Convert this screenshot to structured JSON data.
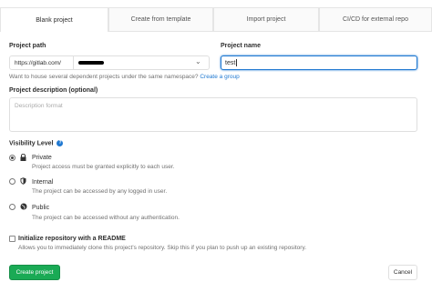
{
  "tabs": [
    {
      "label": "Blank project",
      "active": true
    },
    {
      "label": "Create from template",
      "active": false
    },
    {
      "label": "Import project",
      "active": false
    },
    {
      "label": "CI/CD for external repo",
      "active": false
    }
  ],
  "project_path": {
    "label": "Project path",
    "prefix": "https://gitlab.com/"
  },
  "project_name": {
    "label": "Project name",
    "value": "test"
  },
  "namespace_help": {
    "text": "Want to house several dependent projects under the same namespace?",
    "link": "Create a group"
  },
  "description": {
    "label": "Project description (optional)",
    "placeholder": "Description format"
  },
  "visibility": {
    "label": "Visibility Level",
    "help_icon": "?",
    "options": [
      {
        "icon": "lock-icon",
        "title": "Private",
        "desc": "Project access must be granted explicitly to each user.",
        "selected": true
      },
      {
        "icon": "shield-icon",
        "title": "Internal",
        "desc": "The project can be accessed by any logged in user.",
        "selected": false
      },
      {
        "icon": "globe-icon",
        "title": "Public",
        "desc": "The project can be accessed without any authentication.",
        "selected": false
      }
    ]
  },
  "readme": {
    "label": "Initialize repository with a README",
    "desc": "Allows you to immediately clone this project's repository. Skip this if you plan to push up an existing repository.",
    "checked": false
  },
  "buttons": {
    "create": "Create project",
    "cancel": "Cancel"
  },
  "colors": {
    "primary_green": "#1aaa55",
    "link_blue": "#1f78d1"
  }
}
